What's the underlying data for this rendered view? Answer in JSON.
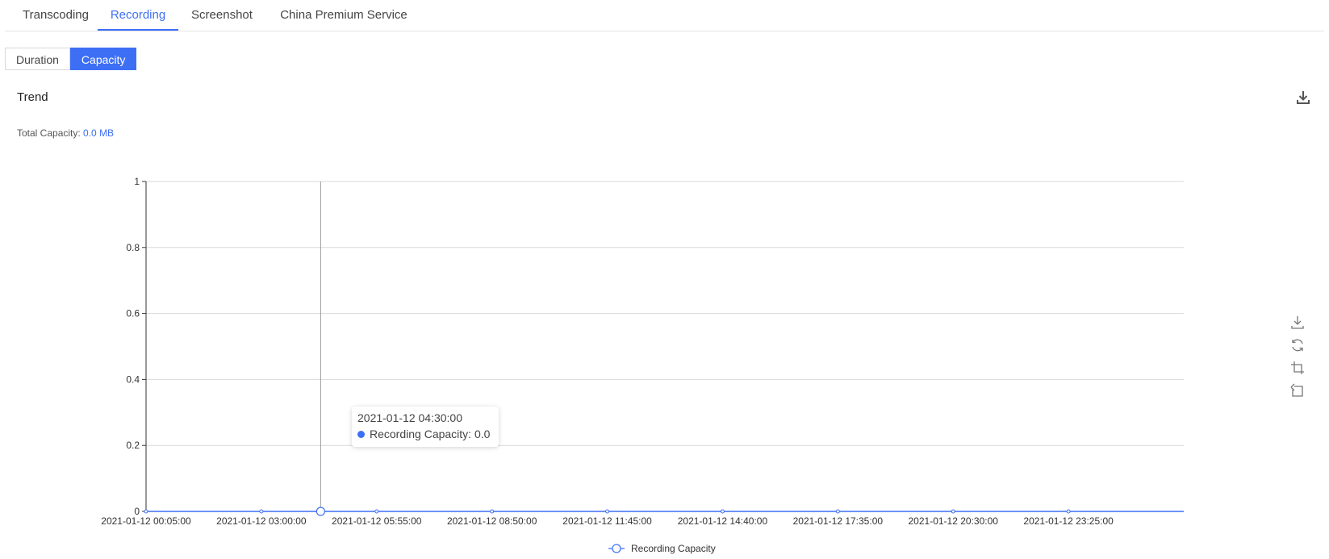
{
  "tabs": [
    {
      "label": "Transcoding",
      "active": false
    },
    {
      "label": "Recording",
      "active": true
    },
    {
      "label": "Screenshot",
      "active": false
    },
    {
      "label": "China Premium Service",
      "active": false
    }
  ],
  "segment": {
    "duration_label": "Duration",
    "capacity_label": "Capacity",
    "selected": "Capacity"
  },
  "section": {
    "title": "Trend"
  },
  "total": {
    "label": "Total Capacity:",
    "value": "0.0 MB"
  },
  "tooltip": {
    "time": "2021-01-12 04:30:00",
    "series": "Recording Capacity",
    "value": "0.0"
  },
  "icons": {
    "top_download": "download-icon",
    "toolbox": [
      "save-image-icon",
      "refresh-icon",
      "zoom-icon",
      "zoom-reset-icon"
    ]
  },
  "colors": {
    "accent": "#3d6ff5",
    "grid": "#d9d9d9",
    "axis": "#333333"
  },
  "chart_data": {
    "type": "line",
    "x": [
      "2021-01-12 00:05:00",
      "2021-01-12 03:00:00",
      "2021-01-12 05:55:00",
      "2021-01-12 08:50:00",
      "2021-01-12 11:45:00",
      "2021-01-12 14:40:00",
      "2021-01-12 17:35:00",
      "2021-01-12 20:30:00",
      "2021-01-12 23:25:00"
    ],
    "series": [
      {
        "name": "Recording Capacity",
        "values": [
          0,
          0,
          0,
          0,
          0,
          0,
          0,
          0,
          0
        ]
      }
    ],
    "highlight": {
      "x": "2021-01-12 04:30:00",
      "value": 0
    },
    "yticks": [
      "0",
      "0.2",
      "0.4",
      "0.6",
      "0.8",
      "1"
    ],
    "ylim": [
      0,
      1
    ],
    "grid": true,
    "legend": "bottom-center"
  }
}
